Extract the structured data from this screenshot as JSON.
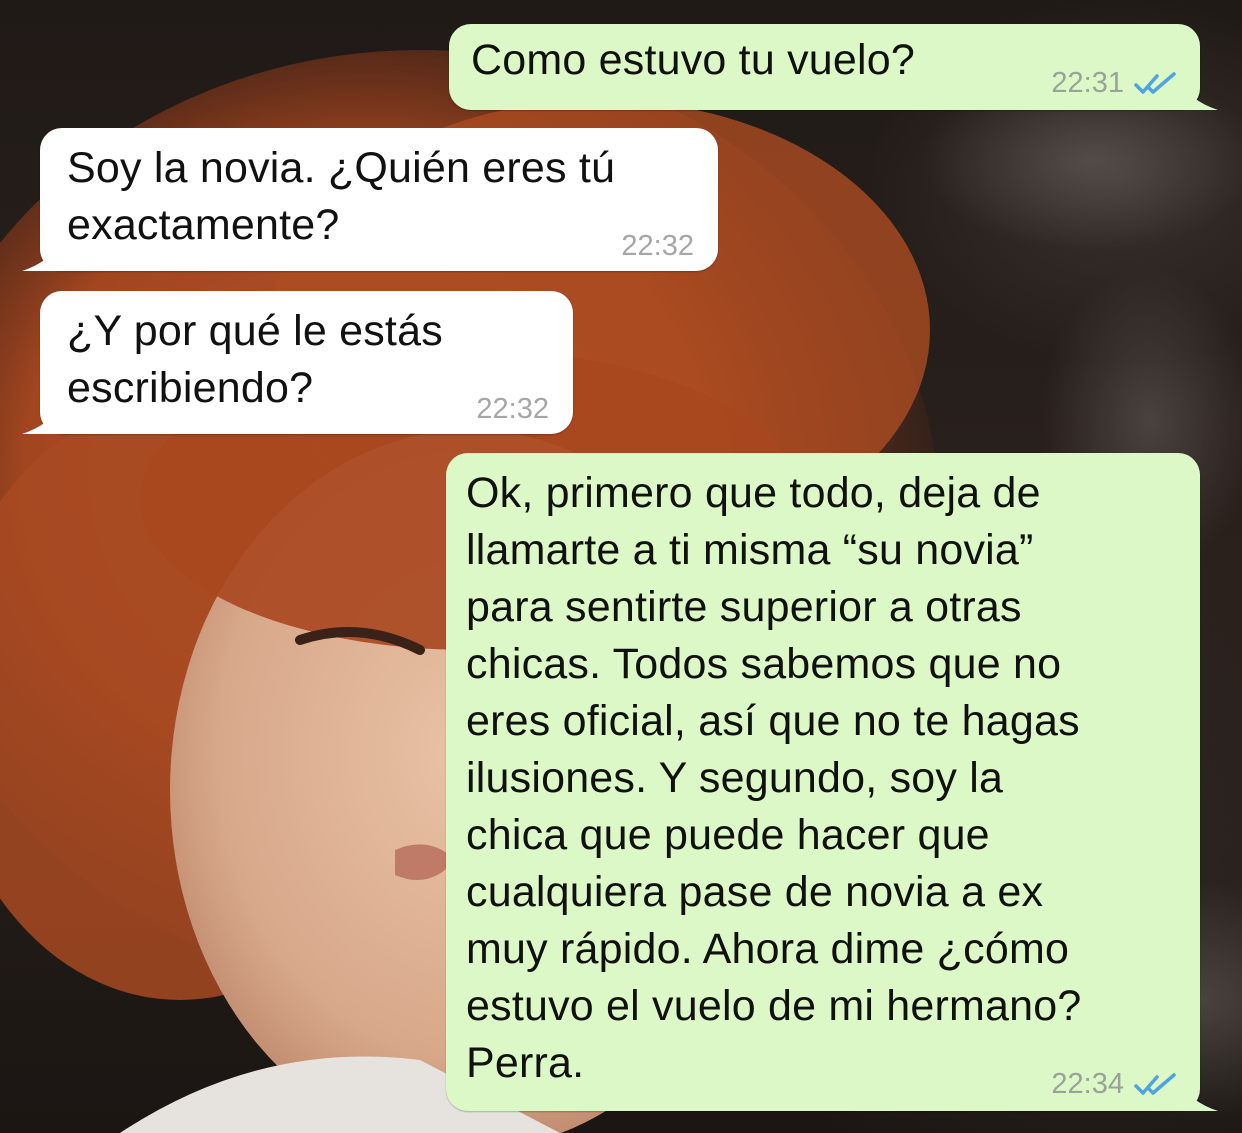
{
  "chat": {
    "messages": [
      {
        "direction": "out",
        "text": "Como estuvo tu vuelo?",
        "time": "22:31",
        "status": "read"
      },
      {
        "direction": "in",
        "text": "Soy la novia. ¿Quién eres tú\nexactamente?",
        "time": "22:32"
      },
      {
        "direction": "in",
        "text": "¿Y por qué le estás\nescribiendo?",
        "time": "22:32"
      },
      {
        "direction": "out",
        "text": "Ok, primero que todo, deja de\nllamarte a ti misma “su novia”\npara sentirte superior a otras\nchicas. Todos sabemos que no\neres oficial, así que no te hagas\nilusiones. Y segundo, soy la\nchica que puede hacer que\ncualquiera pase de novia a ex\nmuy rápido. Ahora dime ¿cómo\nestuvo el vuelo de mi hermano?\nPerra.",
        "time": "22:34",
        "status": "read"
      }
    ]
  },
  "colors": {
    "outgoing_bubble": "#dcf8c6",
    "incoming_bubble": "#ffffff",
    "read_ticks": "#4fa3e0"
  },
  "icons": {
    "read_receipt": "double-check-icon"
  }
}
